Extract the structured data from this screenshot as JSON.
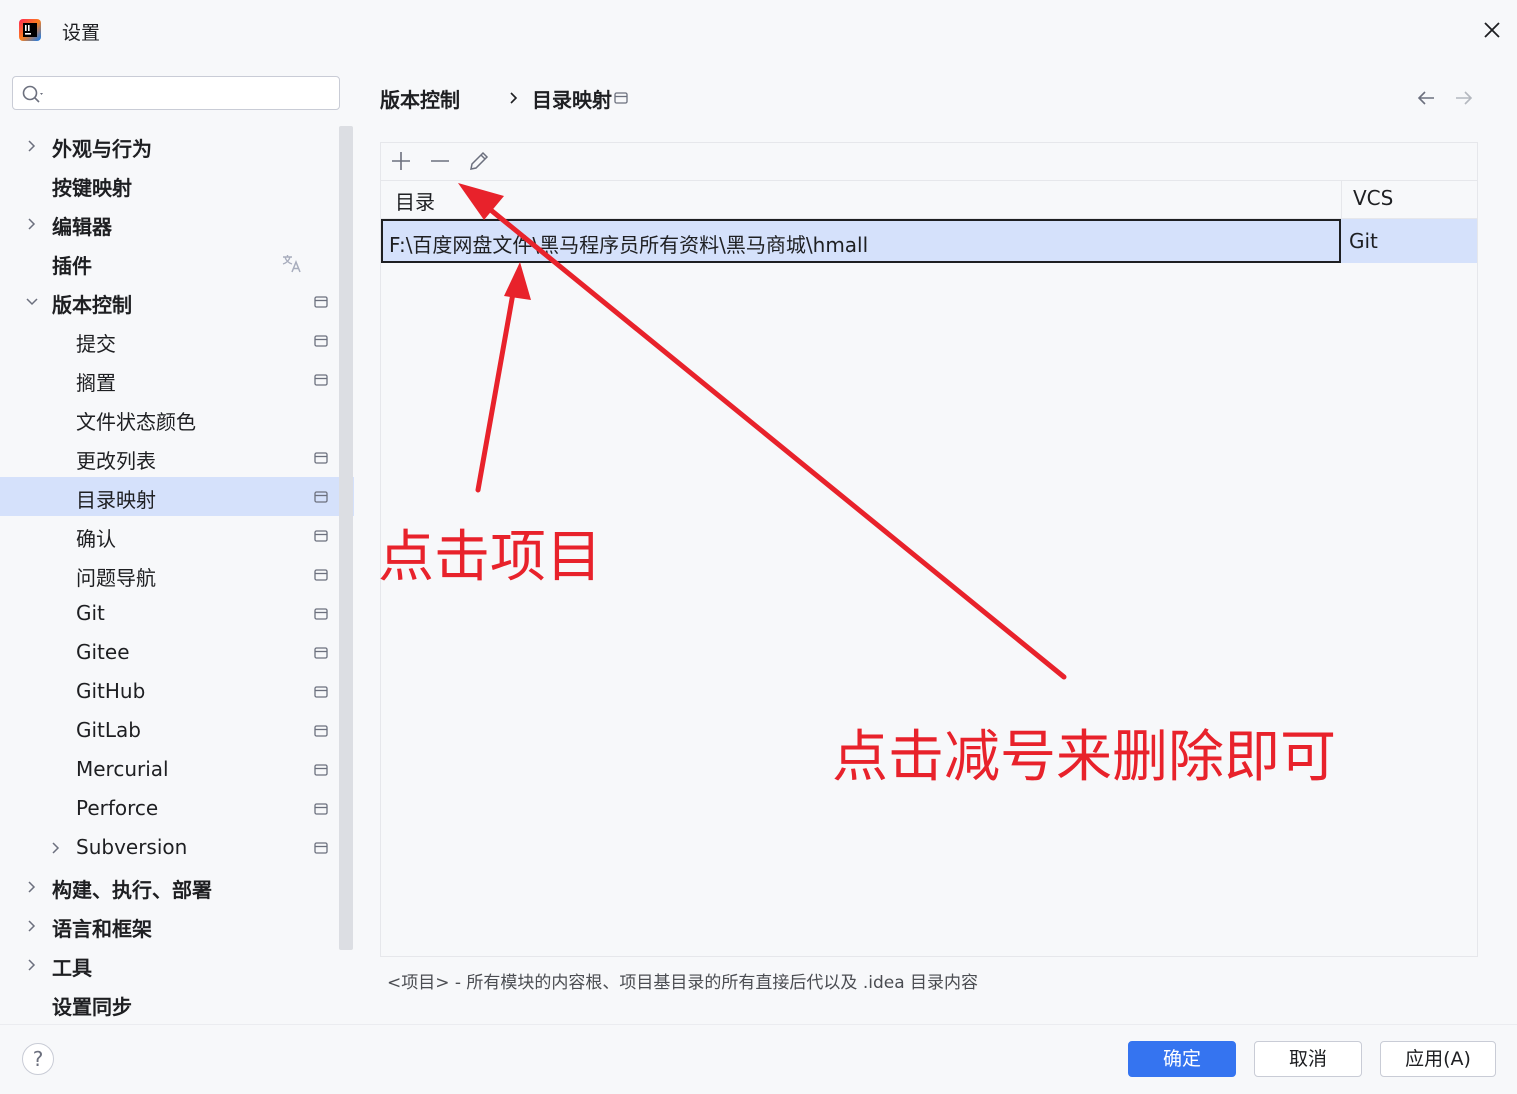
{
  "window": {
    "title": "设置"
  },
  "search": {
    "placeholder": "",
    "value": ""
  },
  "sidebar": {
    "items": [
      {
        "label": "外观与行为"
      },
      {
        "label": "按键映射"
      },
      {
        "label": "编辑器"
      },
      {
        "label": "插件"
      },
      {
        "label": "版本控制"
      },
      {
        "label": "提交"
      },
      {
        "label": "搁置"
      },
      {
        "label": "文件状态颜色"
      },
      {
        "label": "更改列表"
      },
      {
        "label": "目录映射"
      },
      {
        "label": "确认"
      },
      {
        "label": "问题导航"
      },
      {
        "label": "Git"
      },
      {
        "label": "Gitee"
      },
      {
        "label": "GitHub"
      },
      {
        "label": "GitLab"
      },
      {
        "label": "Mercurial"
      },
      {
        "label": "Perforce"
      },
      {
        "label": "Subversion"
      },
      {
        "label": "构建、执行、部署"
      },
      {
        "label": "语言和框架"
      },
      {
        "label": "工具"
      },
      {
        "label": "设置同步"
      }
    ]
  },
  "breadcrumb": {
    "parent": "版本控制",
    "current": "目录映射"
  },
  "table": {
    "columns": [
      "目录",
      "VCS"
    ],
    "rows": [
      {
        "directory": "F:\\百度网盘文件\\黑马程序员所有资料\\黑马商城\\hmall",
        "vcs": "Git"
      }
    ]
  },
  "footnote": "<项目> - 所有模块的内容根、项目基目录的所有直接后代以及 .idea 目录内容",
  "buttons": {
    "ok": "确定",
    "cancel": "取消",
    "apply": "应用(A)"
  },
  "help": "?",
  "annotations": {
    "click_project": "点击项目",
    "click_minus": "点击减号来删除即可"
  },
  "colors": {
    "accent": "#3574f0",
    "selection": "#d5e1fb",
    "annotation": "#e8222b"
  },
  "icons": [
    "search-icon",
    "close-icon",
    "chevron-right-icon",
    "chevron-down-icon",
    "translate-icon",
    "project-level-icon",
    "add-icon",
    "remove-icon",
    "edit-icon",
    "arrow-left-icon",
    "arrow-right-icon"
  ]
}
